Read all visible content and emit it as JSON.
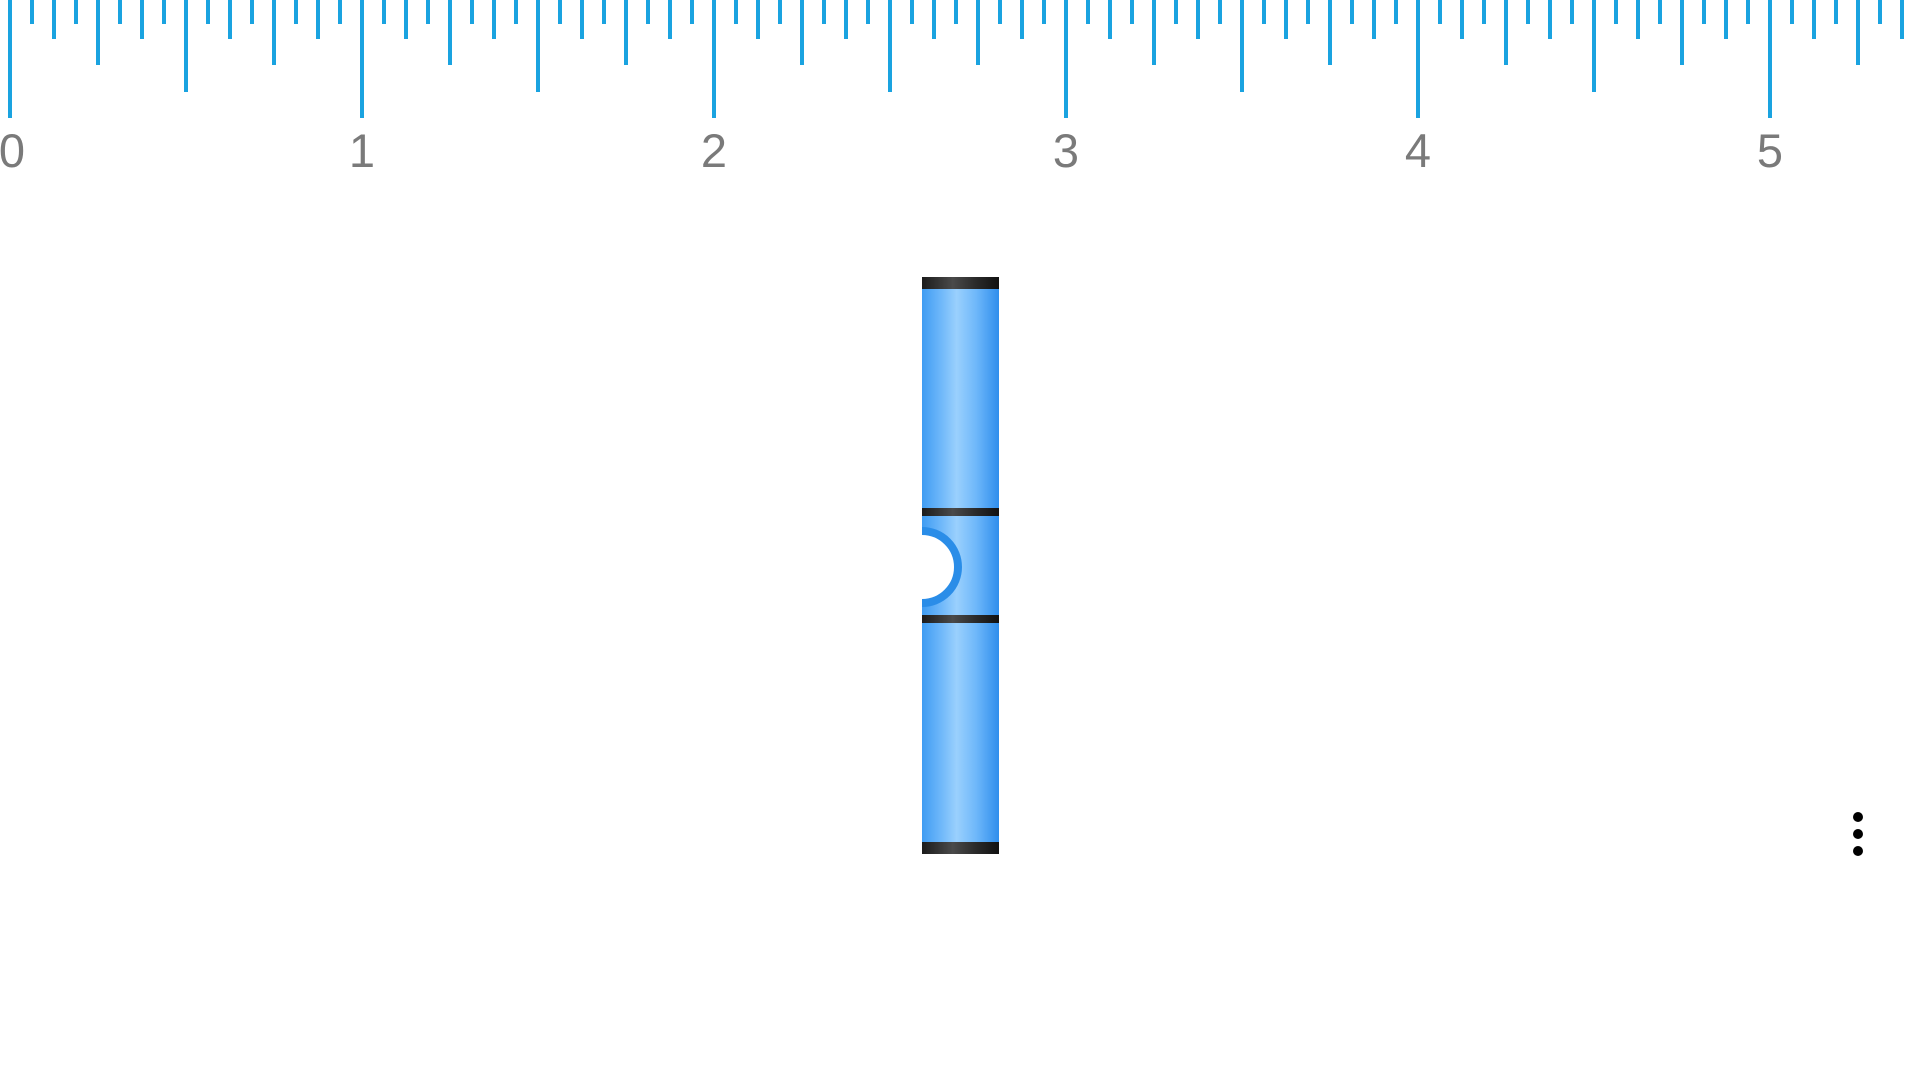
{
  "ruler": {
    "unit_labels": [
      "0",
      "1",
      "2",
      "3",
      "4",
      "5"
    ],
    "subdivisions_per_unit": 16,
    "color": "#1aa3e0",
    "label_color": "#7a7a7a"
  },
  "level": {
    "orientation": "vertical",
    "tube_color": "#6fb8fa",
    "bubble_color": "#ffffff",
    "bubble_ring_color": "#2a8de8",
    "cap_color": "#1b1b1b"
  },
  "menu": {
    "icon": "more-vert-icon"
  }
}
